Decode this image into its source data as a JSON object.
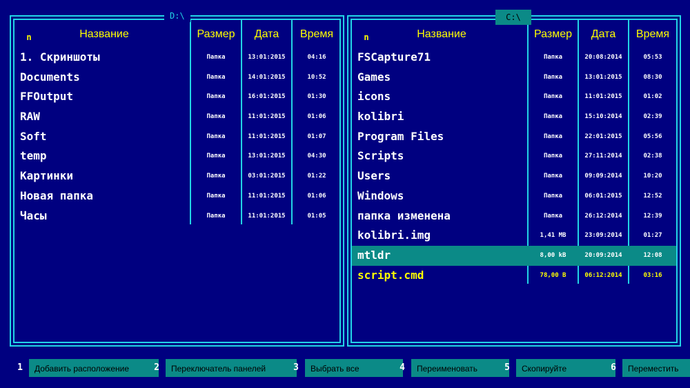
{
  "left_panel": {
    "path": "D:\\",
    "active": false,
    "headers": {
      "marker": "n",
      "name": "Название",
      "size": "Размер",
      "date": "Дата",
      "time": "Время"
    },
    "files": [
      {
        "name": "1. Скриншоты",
        "size": "Папка",
        "date": "13:01:2015",
        "time": "04:16"
      },
      {
        "name": "Documents",
        "size": "Папка",
        "date": "14:01:2015",
        "time": "10:52"
      },
      {
        "name": "FFOutput",
        "size": "Папка",
        "date": "16:01:2015",
        "time": "01:30"
      },
      {
        "name": "RAW",
        "size": "Папка",
        "date": "11:01:2015",
        "time": "01:06"
      },
      {
        "name": "Soft",
        "size": "Папка",
        "date": "11:01:2015",
        "time": "01:07"
      },
      {
        "name": "temp",
        "size": "Папка",
        "date": "13:01:2015",
        "time": "04:30"
      },
      {
        "name": "Картинки",
        "size": "Папка",
        "date": "03:01:2015",
        "time": "01:22"
      },
      {
        "name": "Новая папка",
        "size": "Папка",
        "date": "11:01:2015",
        "time": "01:06"
      },
      {
        "name": "Часы",
        "size": "Папка",
        "date": "11:01:2015",
        "time": "01:05"
      }
    ]
  },
  "right_panel": {
    "path": "C:\\",
    "active": true,
    "headers": {
      "marker": "n",
      "name": "Название",
      "size": "Размер",
      "date": "Дата",
      "time": "Время"
    },
    "files": [
      {
        "name": "FSCapture71",
        "size": "Папка",
        "date": "20:08:2014",
        "time": "05:53"
      },
      {
        "name": "Games",
        "size": "Папка",
        "date": "13:01:2015",
        "time": "08:30"
      },
      {
        "name": "icons",
        "size": "Папка",
        "date": "11:01:2015",
        "time": "01:02"
      },
      {
        "name": "kolibri",
        "size": "Папка",
        "date": "15:10:2014",
        "time": "02:39"
      },
      {
        "name": "Program Files",
        "size": "Папка",
        "date": "22:01:2015",
        "time": "05:56"
      },
      {
        "name": "Scripts",
        "size": "Папка",
        "date": "27:11:2014",
        "time": "02:38"
      },
      {
        "name": "Users",
        "size": "Папка",
        "date": "09:09:2014",
        "time": "10:20"
      },
      {
        "name": "Windows",
        "size": "Папка",
        "date": "06:01:2015",
        "time": "12:52"
      },
      {
        "name": "папка изменена",
        "size": "Папка",
        "date": "26:12:2014",
        "time": "12:39"
      },
      {
        "name": "kolibri.img",
        "size": "1,41 MB",
        "date": "23:09:2014",
        "time": "01:27"
      },
      {
        "name": "mtldr",
        "size": "8,00 kB",
        "date": "20:09:2014",
        "time": "12:08",
        "state": "selected"
      },
      {
        "name": "script.cmd",
        "size": "78,00  B",
        "date": "06:12:2014",
        "time": "03:16",
        "state": "highlight"
      }
    ]
  },
  "function_keys": [
    {
      "num": "1",
      "label": "Добавить расположение"
    },
    {
      "num": "2",
      "label": "Переключатель панелей"
    },
    {
      "num": "3",
      "label": "Выбрать все"
    },
    {
      "num": "4",
      "label": "Переименовать"
    },
    {
      "num": "5",
      "label": "Скопируйте"
    },
    {
      "num": "6",
      "label": "Переместить"
    }
  ],
  "colors": {
    "background": "#000080",
    "border": "#22d4e6",
    "header_text": "#ffff00",
    "selection": "#0b8a87",
    "text": "#ffffff"
  }
}
